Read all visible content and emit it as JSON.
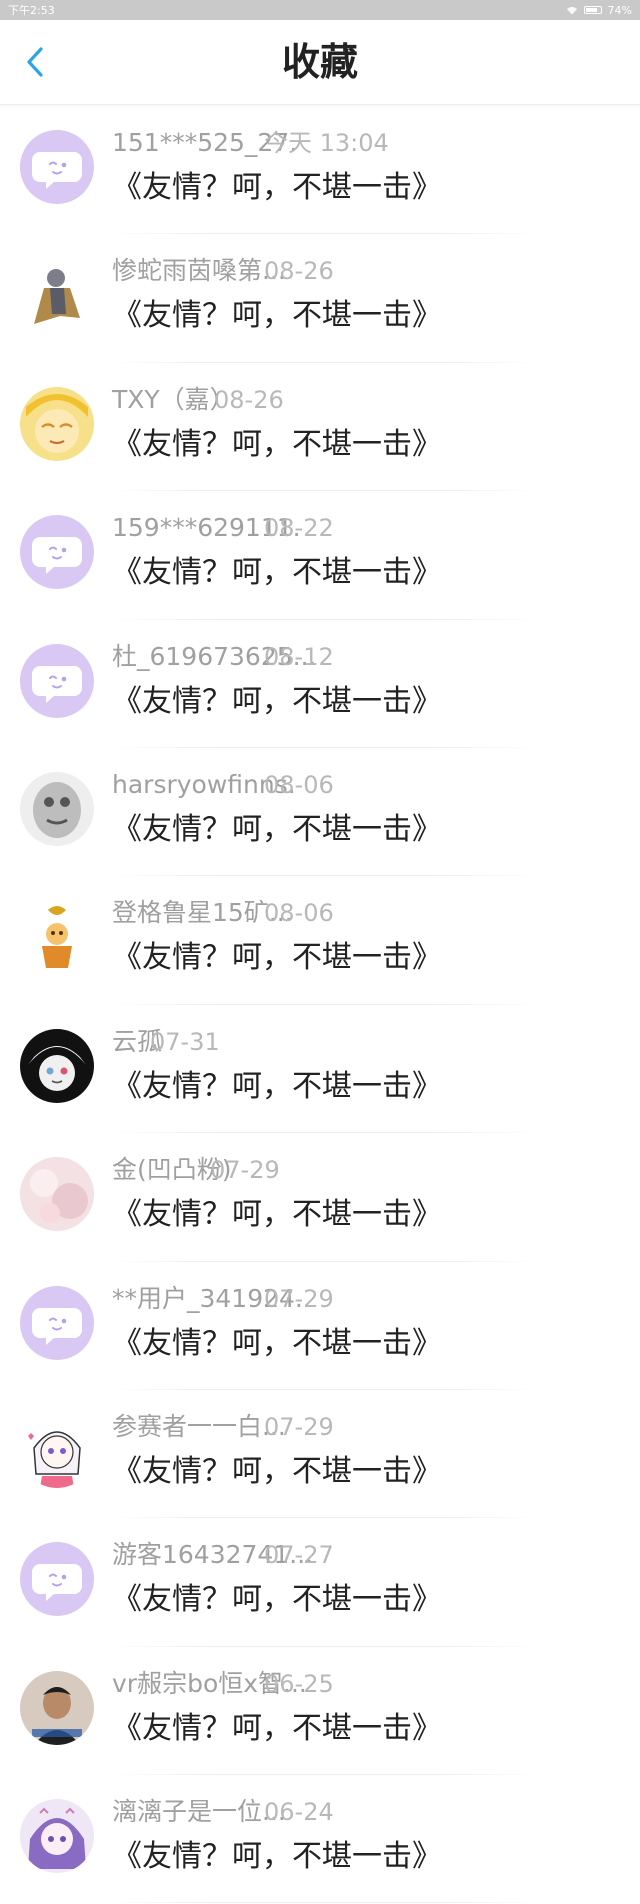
{
  "status_bar": {
    "time": "下午2:53",
    "battery": "74%"
  },
  "header": {
    "title": "收藏"
  },
  "items": [
    {
      "name": "151***525_27.",
      "time": "今天 13:04",
      "message": "《友情？呵，不堪一击》",
      "avatar": "default"
    },
    {
      "name": "惨蛇雨茵嗓第...",
      "time": "08-26",
      "message": "《友情？呵，不堪一击》",
      "avatar": "figure-brown"
    },
    {
      "name": "TXY（嘉）",
      "time": "08-26",
      "message": "《友情？呵，不堪一击》",
      "avatar": "yellow-anime"
    },
    {
      "name": "159***629111.",
      "time": "08-22",
      "message": "《友情？呵，不堪一击》",
      "avatar": "default"
    },
    {
      "name": "杜_619673625...",
      "time": "08-12",
      "message": "《友情？呵，不堪一击》",
      "avatar": "default"
    },
    {
      "name": "harsryowfinns.",
      "time": "08-06",
      "message": "《友情？呵，不堪一击》",
      "avatar": "gray-stone"
    },
    {
      "name": "登格鲁星15矿...",
      "time": "08-06",
      "message": "《友情？呵，不堪一击》",
      "avatar": "gold-figure"
    },
    {
      "name": "云孤",
      "time": "07-31",
      "message": "《友情？呵，不堪一击》",
      "avatar": "dark-anime"
    },
    {
      "name": "金(凹凸粉)",
      "time": "07-29",
      "message": "《友情？呵，不堪一击》",
      "avatar": "pink-light"
    },
    {
      "name": "**用户_341924..",
      "time": "07-29",
      "message": "《友情？呵，不堪一击》",
      "avatar": "default"
    },
    {
      "name": "参赛者一一白...",
      "time": "07-29",
      "message": "《友情？呵，不堪一击》",
      "avatar": "white-anime"
    },
    {
      "name": "游客16432741...",
      "time": "07-27",
      "message": "《友情？呵，不堪一击》",
      "avatar": "default"
    },
    {
      "name": "vr赧宗bo恒x智...",
      "time": "06-25",
      "message": "《友情？呵，不堪一击》",
      "avatar": "photo-man"
    },
    {
      "name": "漓漓子是一位...",
      "time": "06-24",
      "message": "《友情？呵，不堪一击》",
      "avatar": "purple-anime"
    }
  ],
  "colors": {
    "accent": "#2aa6e6",
    "default_avatar": "#d9c8f3",
    "default_avatar_bubble": "#ffffff",
    "name_text": "#a0a0a0",
    "time_text": "#b8b8b8",
    "message_text": "#222222"
  }
}
